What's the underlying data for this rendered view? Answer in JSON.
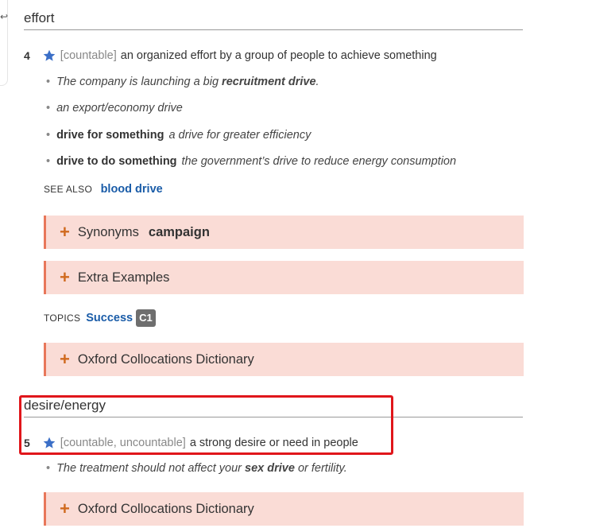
{
  "edge_glyph": "↩",
  "shcut_1": "effort",
  "sense_4": {
    "number": "4",
    "grammar": "[countable]",
    "definition": "an organized effort by a group of people to achieve something",
    "examples": [
      {
        "pre": "The company is launching a big ",
        "bold": "recruitment drive",
        "post": "."
      },
      {
        "pre": "an export/economy drive",
        "bold": "",
        "post": ""
      }
    ],
    "collocations": [
      {
        "cf": "drive for something",
        "text": "a drive for greater efficiency"
      },
      {
        "cf": "drive to do something",
        "text": "the government’s drive to reduce energy consumption"
      }
    ],
    "see_also_label": "SEE ALSO",
    "see_also_link": "blood drive"
  },
  "synonyms_box": {
    "label": "Synonyms",
    "word": "campaign"
  },
  "extra_examples_box": {
    "label": "Extra Examples"
  },
  "topics": {
    "label": "TOPICS",
    "link": "Success",
    "level": "C1"
  },
  "collocations_box_1": {
    "label": "Oxford Collocations Dictionary"
  },
  "shcut_2": "desire/energy",
  "sense_5": {
    "number": "5",
    "grammar": "[countable, uncountable]",
    "definition": "a strong desire or need in people",
    "example": {
      "pre": "The treatment should not affect your ",
      "bold": "sex drive",
      "post": " or fertility."
    }
  },
  "collocations_box_2": {
    "label": "Oxford Collocations Dictionary"
  },
  "colors": {
    "star": "#3b6fc7",
    "link": "#1a5ca8",
    "box_bg": "#fadcd6",
    "box_border": "#e8775a",
    "plus": "#d06a1e",
    "highlight": "#e0161b"
  }
}
